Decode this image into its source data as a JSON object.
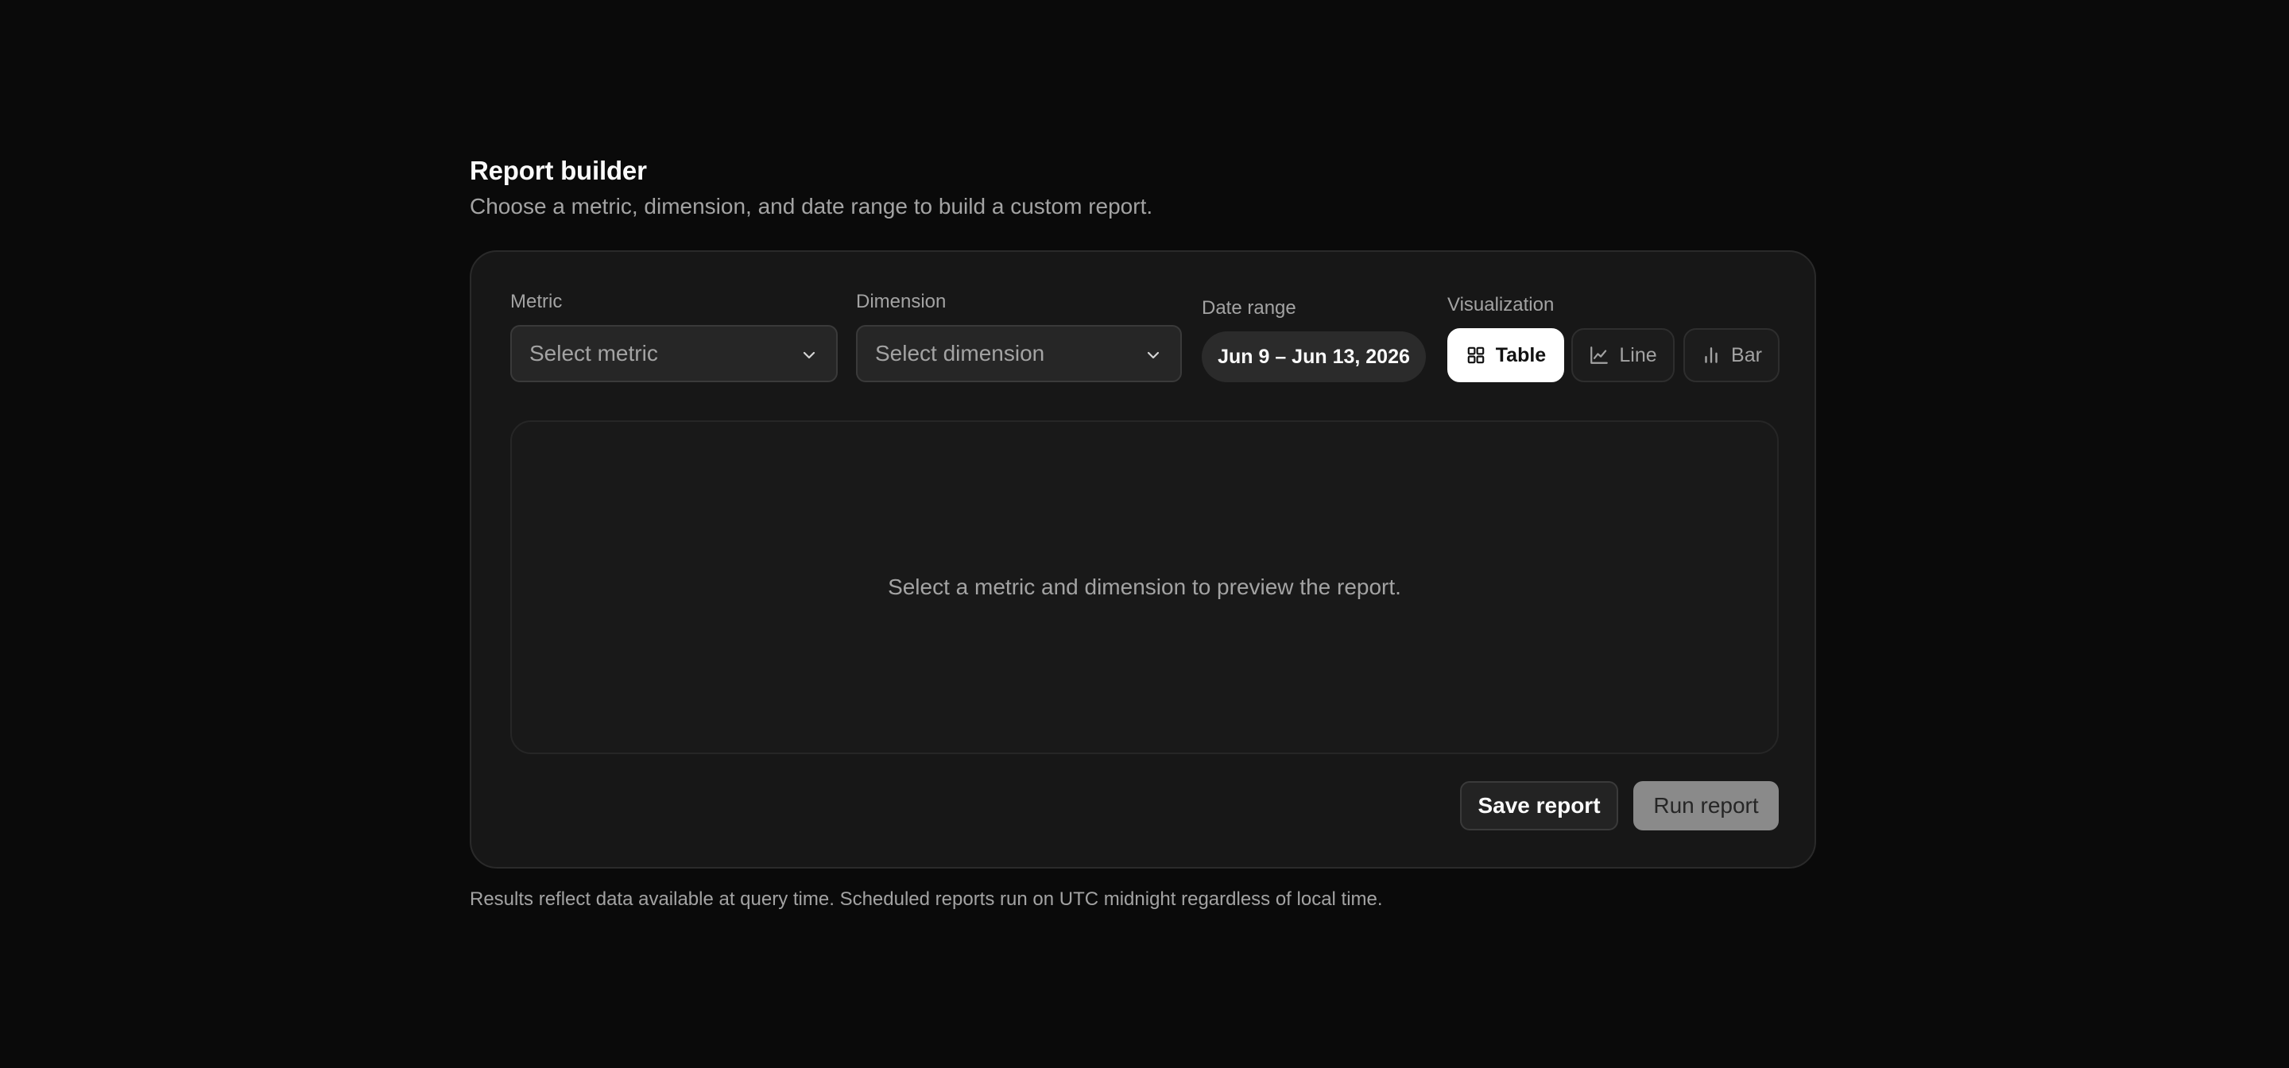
{
  "header": {
    "title": "Report builder",
    "subtitle": "Choose a metric, dimension, and date range to build a custom report."
  },
  "form": {
    "metric": {
      "label": "Metric",
      "placeholder": "Select metric"
    },
    "dimension": {
      "label": "Dimension",
      "placeholder": "Select dimension"
    },
    "date_range": {
      "label": "Date range",
      "value": "Jun 9 – Jun 13, 2026"
    },
    "visualization": {
      "label": "Visualization",
      "selected": "Table",
      "options": [
        {
          "label": "Table",
          "icon": "grid-icon"
        },
        {
          "label": "Line",
          "icon": "line-chart-icon"
        },
        {
          "label": "Bar",
          "icon": "bar-chart-icon"
        }
      ]
    }
  },
  "preview": {
    "empty_message": "Select a metric and dimension to preview the report."
  },
  "actions": {
    "save_label": "Save report",
    "run_label": "Run report"
  },
  "footnote": "Results reflect data available at query time. Scheduled reports run on UTC midnight regardless of local time.",
  "colors": {
    "background": "#0a0a0a",
    "card": "#171717",
    "active_toggle": "#ffffff",
    "run_button_disabled": "#8a8a8a"
  }
}
